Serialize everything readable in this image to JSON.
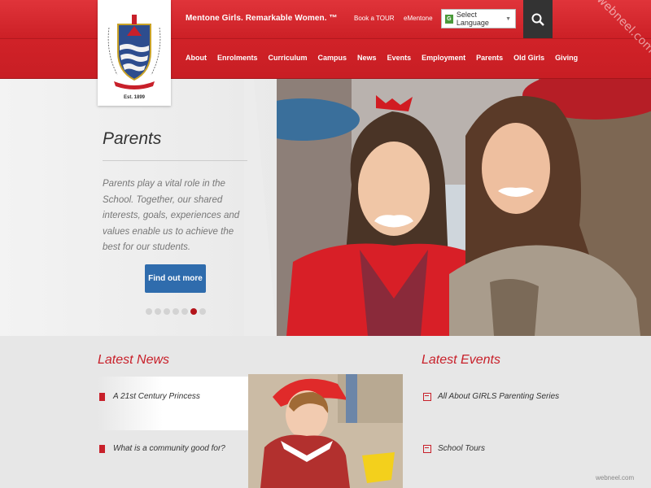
{
  "header": {
    "tagline": "Mentone Girls. Remarkable Women. ™",
    "links": [
      "Book a TOUR",
      "eMentone"
    ],
    "language": "Select Language",
    "established": "Est. 1899",
    "nav": [
      "About",
      "Enrolments",
      "Curriculum",
      "Campus",
      "News",
      "Events",
      "Employment",
      "Parents",
      "Old Girls",
      "Giving"
    ]
  },
  "hero": {
    "title": "Parents",
    "body": "Parents play a vital role in the School. Together, our shared interests, goals, experiences and values enable us to achieve the best for our students.",
    "cta": "Find out more",
    "slides": 7,
    "active_slide": 6
  },
  "news": {
    "title": "Latest News",
    "items": [
      "A 21st Century Princess",
      "What is a community good for?"
    ]
  },
  "events": {
    "title": "Latest Events",
    "items": [
      "All About GIRLS Parenting Series",
      "School Tours"
    ]
  },
  "watermark": "webneel.com",
  "footer_watermark": "webneel.com",
  "colors": {
    "brand_red": "#c81e24",
    "button_blue": "#2f6cad",
    "accent_red": "#c8202a"
  }
}
